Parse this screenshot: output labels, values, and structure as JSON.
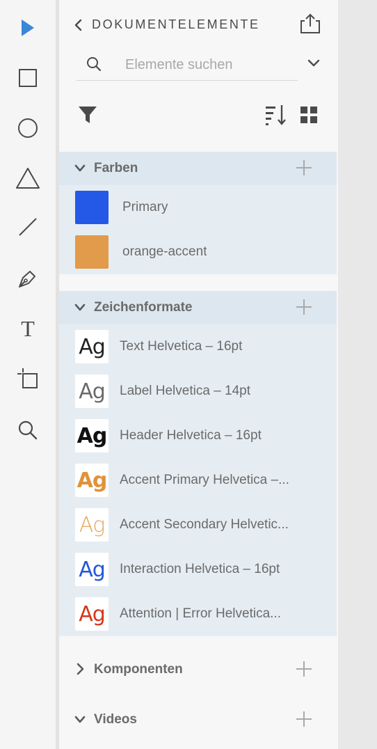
{
  "toolbar": {
    "tools": [
      {
        "name": "select-tool",
        "icon": "pointer-icon",
        "active": true
      },
      {
        "name": "rectangle-tool",
        "icon": "rectangle-icon"
      },
      {
        "name": "ellipse-tool",
        "icon": "ellipse-icon"
      },
      {
        "name": "polygon-tool",
        "icon": "triangle-icon"
      },
      {
        "name": "line-tool",
        "icon": "line-icon"
      },
      {
        "name": "pen-tool",
        "icon": "pen-icon"
      },
      {
        "name": "text-tool",
        "icon": "text-icon"
      },
      {
        "name": "artboard-tool",
        "icon": "artboard-icon"
      },
      {
        "name": "zoom-tool",
        "icon": "magnifier-icon"
      }
    ],
    "text_tool_glyph": "T",
    "accent_color": "#3a86d8"
  },
  "panel": {
    "title": "DOKUMENTELEMENTE",
    "search": {
      "placeholder": "Elemente suchen",
      "value": ""
    },
    "sections": {
      "colors": {
        "title": "Farben",
        "items": [
          {
            "label": "Primary",
            "color": "#2458e6"
          },
          {
            "label": "orange-accent",
            "color": "#e19b4b"
          }
        ]
      },
      "character_styles": {
        "title": "Zeichenformate",
        "items": [
          {
            "glyph": "Ag",
            "label": "Text Helvetica – 16pt",
            "color": "#222222",
            "weight": "normal"
          },
          {
            "glyph": "Ag",
            "label": "Label Helvetica – 14pt",
            "color": "#6a6a6a",
            "weight": "normal"
          },
          {
            "glyph": "Ag",
            "label": "Header Helvetica – 16pt",
            "color": "#111111",
            "weight": "bold"
          },
          {
            "glyph": "Ag",
            "label": "Accent Primary Helvetica –...",
            "color": "#e0923b",
            "weight": "bold"
          },
          {
            "glyph": "Ag",
            "label": "Accent Secondary Helvetic...",
            "color": "#e7a55a",
            "weight": "lighter"
          },
          {
            "glyph": "Ag",
            "label": "Interaction Helvetica – 16pt",
            "color": "#2356d9",
            "weight": "normal"
          },
          {
            "glyph": "Ag",
            "label": "Attention | Error Helvetica...",
            "color": "#d6361a",
            "weight": "normal"
          }
        ]
      },
      "components": {
        "title": "Komponenten"
      },
      "videos": {
        "title": "Videos"
      }
    }
  }
}
